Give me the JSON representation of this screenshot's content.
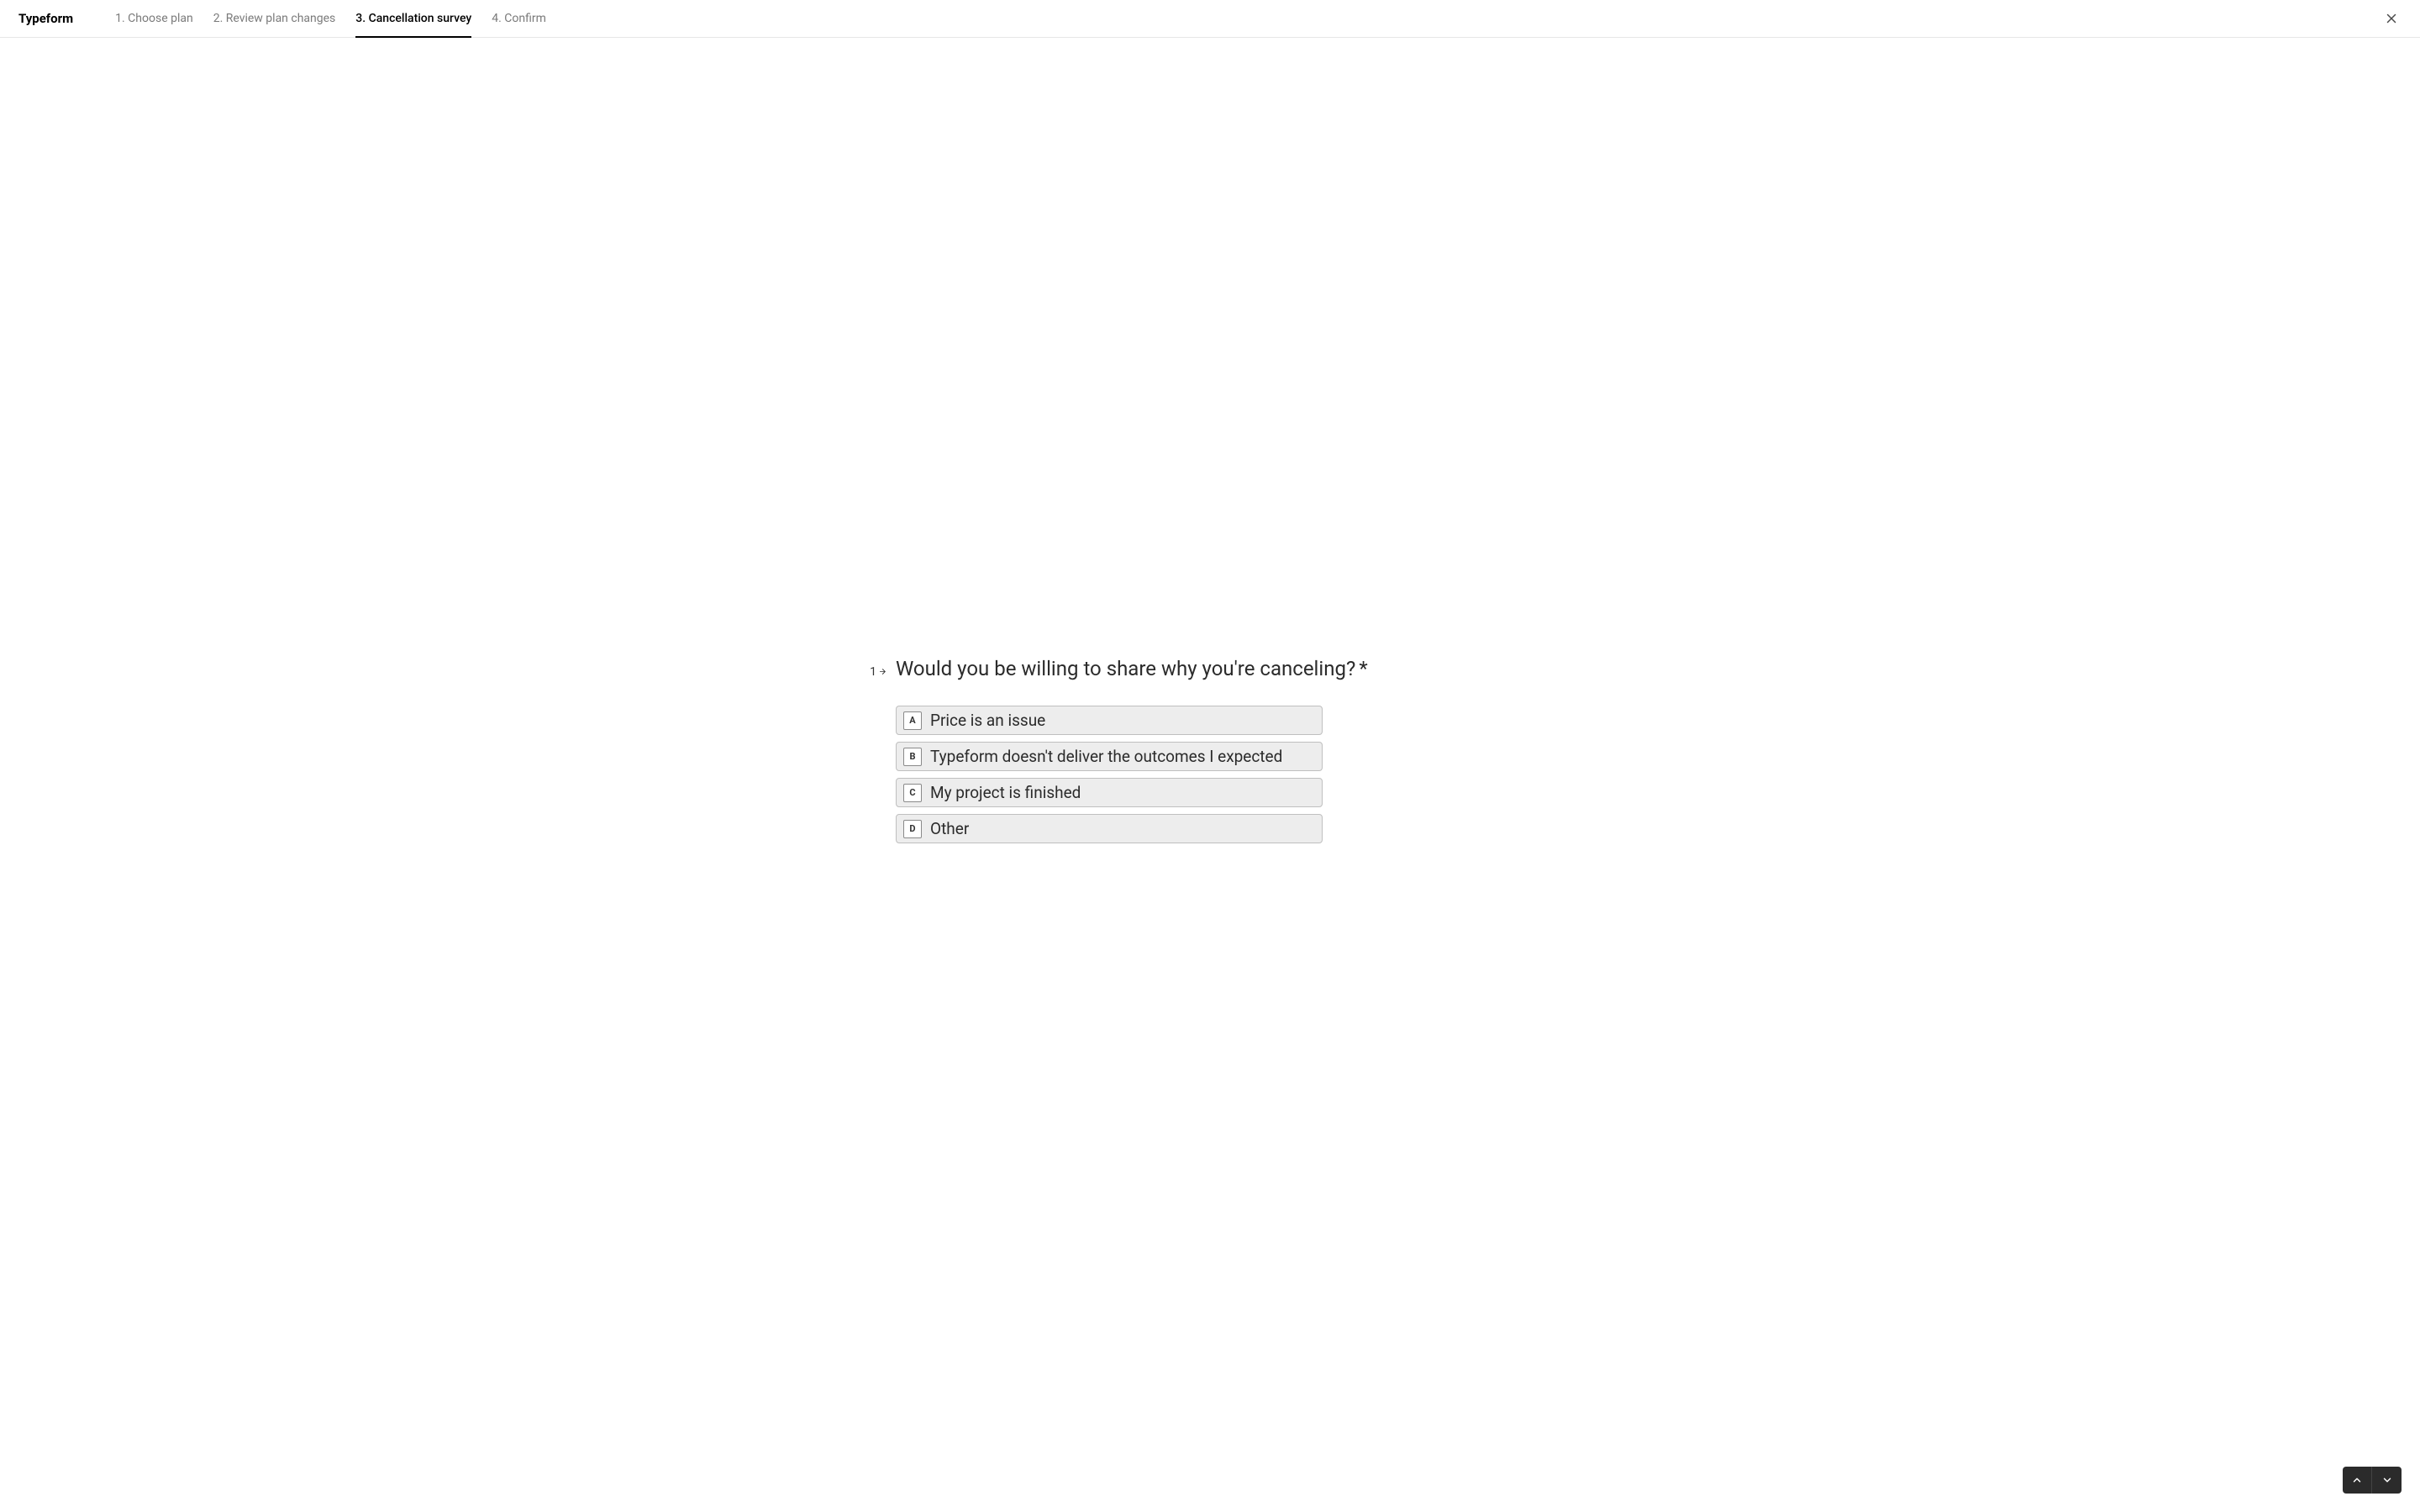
{
  "brand": "Typeform",
  "steps": [
    {
      "label": "1. Choose plan",
      "active": false
    },
    {
      "label": "2. Review plan changes",
      "active": false
    },
    {
      "label": "3. Cancellation survey",
      "active": true
    },
    {
      "label": "4. Confirm",
      "active": false
    }
  ],
  "question": {
    "number": "1",
    "text": "Would you be willing to share why you're canceling?",
    "required": "*",
    "options": [
      {
        "key": "A",
        "label": "Price is an issue"
      },
      {
        "key": "B",
        "label": "Typeform doesn't deliver the outcomes I expected"
      },
      {
        "key": "C",
        "label": "My project is finished"
      },
      {
        "key": "D",
        "label": "Other"
      }
    ]
  }
}
